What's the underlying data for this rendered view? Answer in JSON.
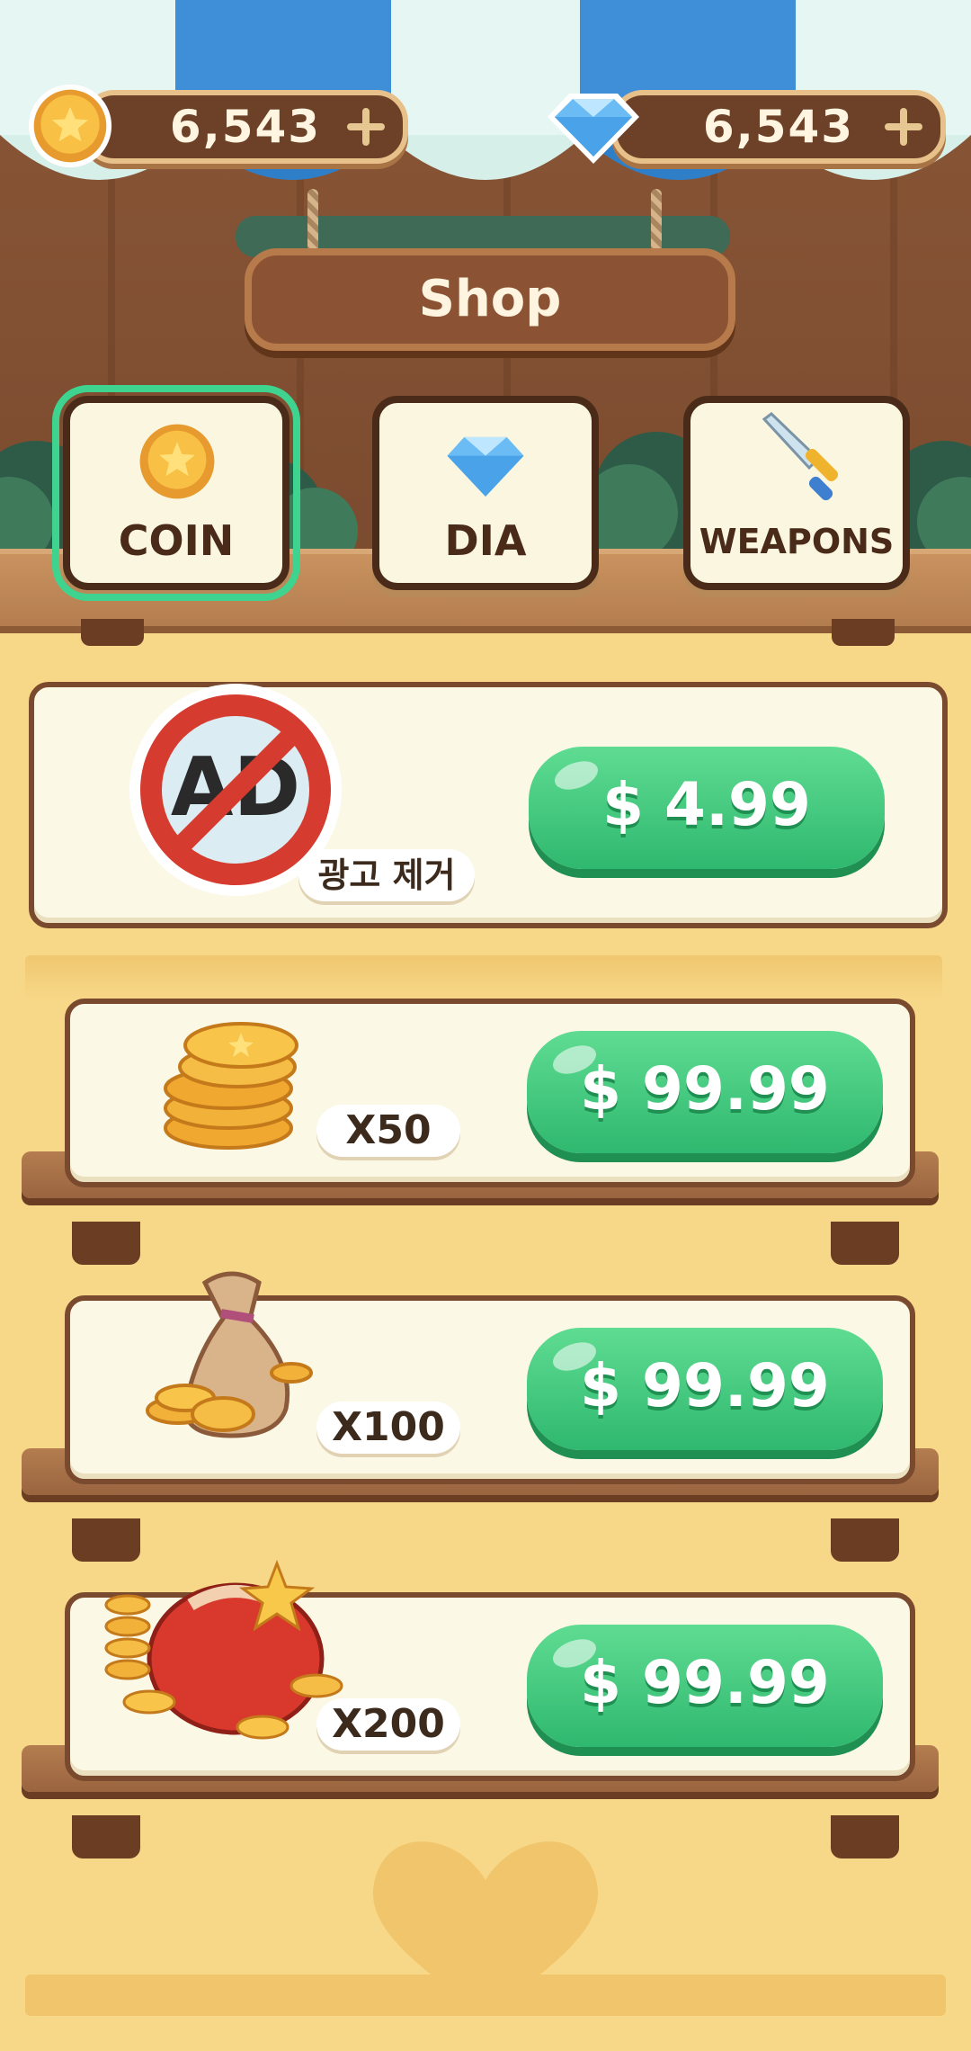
{
  "header": {
    "coin_balance": "6,543",
    "dia_balance": "6,543",
    "sign_title": "Shop"
  },
  "tabs": [
    {
      "label": "COIN",
      "icon": "coin-icon",
      "selected": true
    },
    {
      "label": "DIA",
      "icon": "diamond-icon",
      "selected": false
    },
    {
      "label": "WEAPONS",
      "icon": "sword-icon",
      "selected": false
    }
  ],
  "products": [
    {
      "icon": "no-ads-icon",
      "icon_text": "AD",
      "label": "광고 제거",
      "price": "$ 4.99"
    },
    {
      "icon": "coin-stack-icon",
      "label": "X50",
      "price": "$ 99.99"
    },
    {
      "icon": "coin-sack-icon",
      "label": "X100",
      "price": "$ 99.99"
    },
    {
      "icon": "coin-bag-icon",
      "label": "X200",
      "price": "$ 99.99"
    }
  ],
  "colors": {
    "accent_green": "#3ed38f",
    "price_button": "#2fb86f",
    "wood_dark": "#4a2b1a",
    "background": "#f7d888"
  }
}
